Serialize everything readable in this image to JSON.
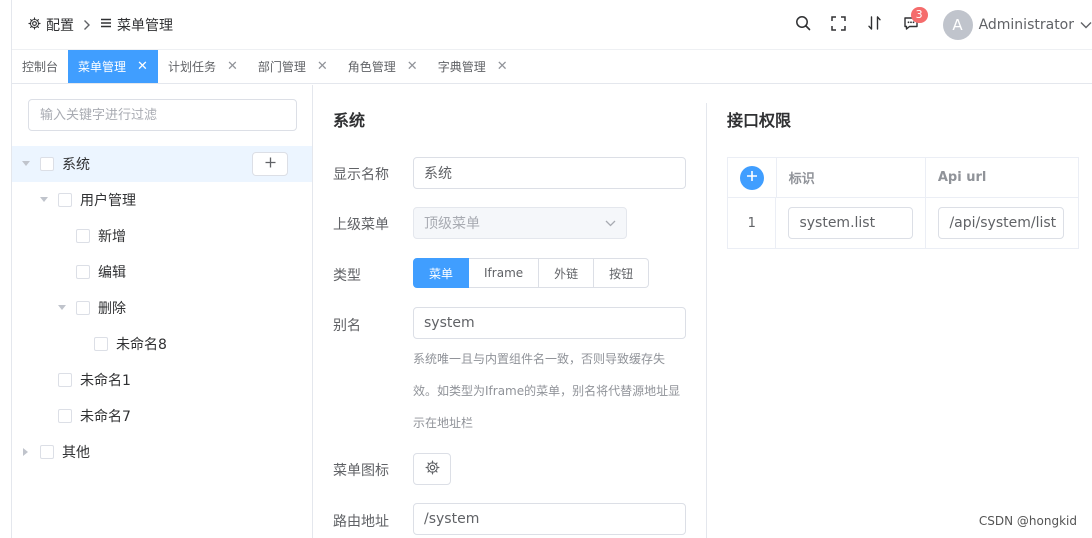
{
  "header": {
    "breadcrumb": [
      {
        "icon": "gear-icon",
        "label": "配置"
      },
      {
        "icon": "menu-lines-icon",
        "label": "菜单管理"
      }
    ],
    "notifications_count": "3",
    "user": {
      "avatar_letter": "A",
      "name": "Administrator"
    }
  },
  "tabs": [
    {
      "label": "控制台",
      "closable": false,
      "active": false
    },
    {
      "label": "菜单管理",
      "closable": true,
      "active": true
    },
    {
      "label": "计划任务",
      "closable": true,
      "active": false
    },
    {
      "label": "部门管理",
      "closable": true,
      "active": false
    },
    {
      "label": "角色管理",
      "closable": true,
      "active": false
    },
    {
      "label": "字典管理",
      "closable": true,
      "active": false
    }
  ],
  "tree": {
    "filter_placeholder": "输入关键字进行过滤",
    "nodes": [
      {
        "label": "系统",
        "level": 0,
        "arrow": "expanded",
        "selected": true
      },
      {
        "label": "用户管理",
        "level": 1,
        "arrow": "expanded"
      },
      {
        "label": "新增",
        "level": 2,
        "arrow": "none"
      },
      {
        "label": "编辑",
        "level": 2,
        "arrow": "none"
      },
      {
        "label": "删除",
        "level": 2,
        "arrow": "expanded"
      },
      {
        "label": "未命名8",
        "level": 3,
        "arrow": "none"
      },
      {
        "label": "未命名1",
        "level": 1,
        "arrow": "none"
      },
      {
        "label": "未命名7",
        "level": 1,
        "arrow": "none"
      },
      {
        "label": "其他",
        "level": 0,
        "arrow": "collapsed"
      }
    ]
  },
  "form": {
    "section_title": "系统",
    "display_name": {
      "label": "显示名称",
      "value": "系统"
    },
    "parent_menu": {
      "label": "上级菜单",
      "value": "顶级菜单"
    },
    "type": {
      "label": "类型",
      "options": [
        "菜单",
        "Iframe",
        "外链",
        "按钮"
      ],
      "selected": "菜单"
    },
    "alias": {
      "label": "别名",
      "value": "system",
      "hint_lines": [
        "系统唯一且与内置组件名一致，否则导致缓存失",
        "效。如类型为Iframe的菜单，别名将代替源地址显",
        "示在地址栏"
      ]
    },
    "menu_icon": {
      "label": "菜单图标"
    },
    "route": {
      "label": "路由地址",
      "value": "/system"
    }
  },
  "api": {
    "section_title": "接口权限",
    "columns": [
      "标识",
      "Api url"
    ],
    "rows": [
      {
        "index": "1",
        "code": "system.list",
        "url": "/api/system/list"
      }
    ]
  },
  "watermark": "CSDN @hongkid",
  "colors": {
    "primary": "#409eff",
    "danger": "#f56c6c",
    "border": "#dcdfe6"
  }
}
